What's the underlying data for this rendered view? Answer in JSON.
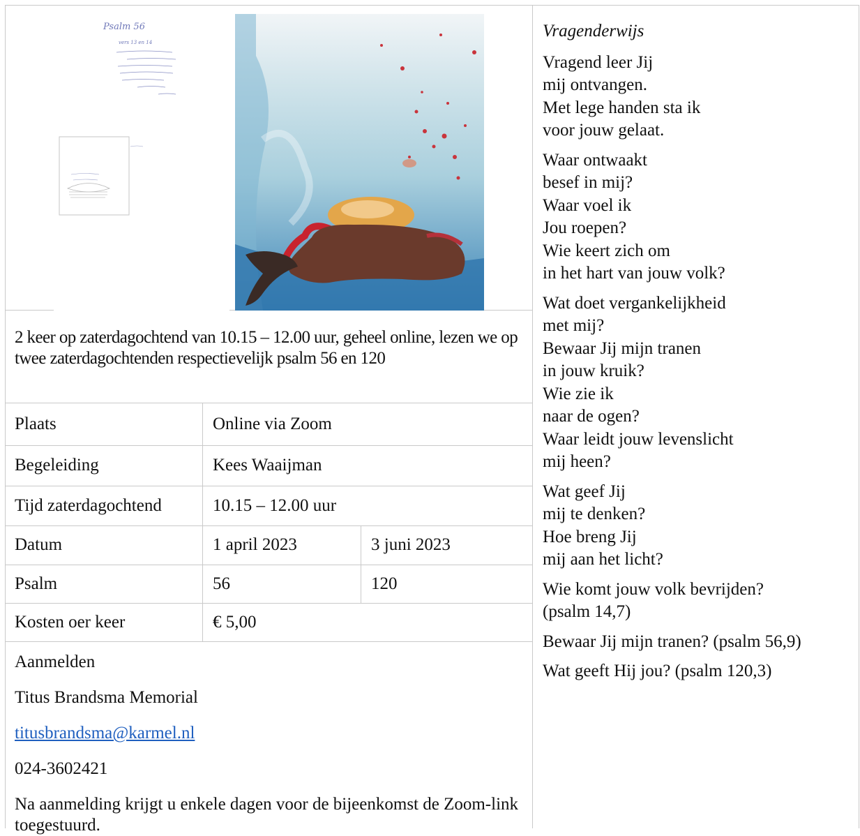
{
  "artwork": {
    "sketch_title": "Psalm 56",
    "sketch_subtitle": "vers 13 en 14"
  },
  "description": "2 keer op zaterdagochtend van 10.15 – 12.00 uur, geheel online, lezen we op twee zaterdagochtenden respectievelijk psalm 56 en 120",
  "details": [
    {
      "label": "Plaats",
      "value": "Online via Zoom"
    },
    {
      "label": "Begeleiding",
      "value": "Kees Waaijman"
    },
    {
      "label": "Tijd zaterdagochtend",
      "value": "10.15 – 12.00 uur"
    },
    {
      "label": "Datum",
      "value": "1 april 2023",
      "value2": "3 juni 2023"
    },
    {
      "label": "Psalm",
      "value": "56",
      "value2": "120"
    },
    {
      "label": "Kosten oer keer",
      "value": "€ 5,00"
    }
  ],
  "contact": {
    "heading": "Aanmelden",
    "org": "Titus Brandsma Memorial",
    "email": "titusbrandsma@karmel.nl",
    "phone": "024-3602421",
    "note": "Na aanmelding krijgt u enkele dagen voor de bijeenkomst de Zoom-link toegestuurd."
  },
  "poem": {
    "title": "Vragenderwijs",
    "stanzas": [
      [
        "Vragend leer Jij",
        "mij ontvangen.",
        "Met lege handen sta ik",
        "voor jouw gelaat."
      ],
      [
        "Waar ontwaakt",
        "besef in mij?",
        "Waar voel ik",
        "Jou roepen?",
        "Wie keert zich om",
        "in het hart van jouw volk?"
      ],
      [
        "Wat doet vergankelijkheid",
        "met mij?",
        "Bewaar Jij mijn tranen",
        "in jouw kruik?",
        "Wie zie ik",
        "naar de ogen?",
        "Waar leidt jouw levenslicht",
        "mij heen?"
      ],
      [
        "Wat geef Jij",
        "mij te denken?",
        "Hoe breng Jij",
        "mij aan het licht?"
      ],
      [
        "Wie komt jouw volk bevrijden?",
        " (psalm 14,7)"
      ],
      [
        "Bewaar Jij mijn tranen? (psalm 56,9)"
      ],
      [
        "Wat geeft Hij jou? (psalm 120,3)"
      ]
    ]
  }
}
